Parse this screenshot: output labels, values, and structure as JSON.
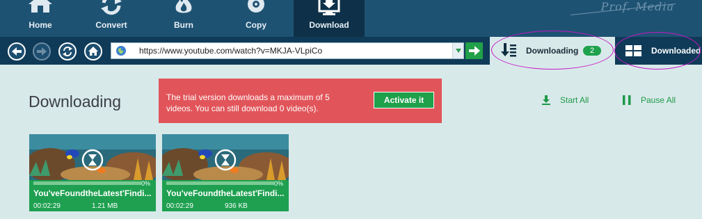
{
  "nav": {
    "items": [
      {
        "label": "Home",
        "icon": "home-icon"
      },
      {
        "label": "Convert",
        "icon": "convert-icon"
      },
      {
        "label": "Burn",
        "icon": "burn-icon"
      },
      {
        "label": "Copy",
        "icon": "copy-icon"
      },
      {
        "label": "Download",
        "icon": "download-icon",
        "active": true
      }
    ],
    "brand": "Prof. Media"
  },
  "toolbar": {
    "url": "https://www.youtube.com/watch?v=MKJA-VLpiCo"
  },
  "tabs": {
    "downloading": {
      "label": "Downloading",
      "count": "2"
    },
    "downloaded": {
      "label": "Downloaded"
    }
  },
  "main": {
    "title": "Downloading",
    "trial_message": "The trial version downloads a maximum of 5 videos. You can still download 0 video(s).",
    "activate_label": "Activate it",
    "start_all": "Start All",
    "pause_all": "Pause All"
  },
  "videos": [
    {
      "title": "You'veFoundtheLatest'Findi...",
      "progress_label": "0%",
      "progress": 0.0,
      "duration": "00:02:29",
      "size": "1.21 MB"
    },
    {
      "title": "You'veFoundtheLatest'Findi...",
      "progress_label": "0%",
      "progress": 0.0,
      "duration": "00:02:29",
      "size": "936 KB"
    }
  ],
  "colors": {
    "nav_bg": "#1e5272",
    "toolbar_bg": "#0f3b58",
    "accent_green": "#1ea050",
    "alert_red": "#e1555a",
    "content_bg": "#d8e9ea"
  }
}
